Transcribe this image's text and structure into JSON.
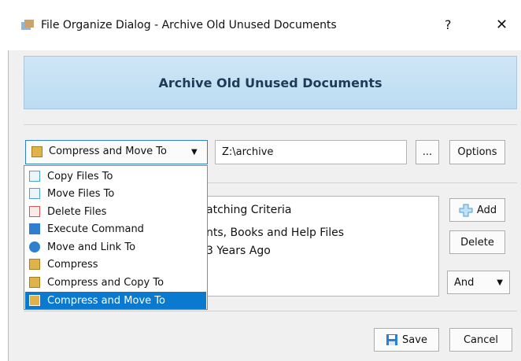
{
  "window": {
    "title": "File Organize Dialog - Archive Old Unused Documents",
    "help": "?",
    "close": "✕"
  },
  "banner": {
    "title": "Archive Old Unused Documents"
  },
  "action": {
    "selected": "Compress and Move To",
    "path": "Z:\\archive",
    "browse": "...",
    "options": "Options"
  },
  "menu": {
    "items": [
      {
        "label": "Copy Files To",
        "icon": "copy-icon",
        "color": "#4c9fd8"
      },
      {
        "label": "Move Files To",
        "icon": "move-icon",
        "color": "#4c9fd8"
      },
      {
        "label": "Delete Files",
        "icon": "delete-icon",
        "color": "#d9534f"
      },
      {
        "label": "Execute Command",
        "icon": "execute-icon",
        "color": "#2f7fd1"
      },
      {
        "label": "Move and Link To",
        "icon": "link-icon",
        "color": "#2f7fd1"
      },
      {
        "label": "Compress",
        "icon": "compress-icon",
        "color": "#e0b24a"
      },
      {
        "label": "Compress and Copy To",
        "icon": "compress-copy-icon",
        "color": "#e0b24a"
      },
      {
        "label": "Compress and Move To",
        "icon": "compress-move-icon",
        "color": "#e0b24a"
      }
    ]
  },
  "criteria": {
    "lines": [
      "atching Criteria",
      "nts, Books and Help Files",
      "3 Years Ago"
    ],
    "add": "Add",
    "delete": "Delete",
    "logic": "And"
  },
  "footer": {
    "save": "Save",
    "cancel": "Cancel"
  }
}
